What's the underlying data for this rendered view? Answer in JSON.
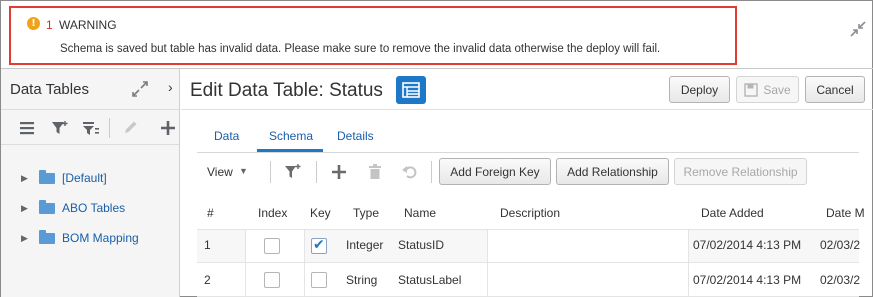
{
  "warning": {
    "icon": "warning-icon",
    "count": "1",
    "title": "WARNING",
    "message": "Schema is saved but table has invalid data. Please make sure to remove the invalid data otherwise the deploy will fail."
  },
  "left_panel": {
    "title": "Data Tables",
    "close_glyph": "›",
    "tree": [
      {
        "label": "[Default]"
      },
      {
        "label": "ABO Tables"
      },
      {
        "label": "BOM Mapping"
      }
    ]
  },
  "main": {
    "title": "Edit Data Table: Status",
    "buttons": {
      "deploy": "Deploy",
      "save": "Save",
      "cancel": "Cancel"
    },
    "tabs": [
      {
        "label": "Data"
      },
      {
        "label": "Schema"
      },
      {
        "label": "Details"
      }
    ],
    "active_tab": "Schema",
    "toolbar": {
      "view_label": "View",
      "add_foreign_key": "Add Foreign Key",
      "add_relationship": "Add Relationship",
      "remove_relationship": "Remove Relationship"
    },
    "table": {
      "headers": {
        "num": "#",
        "index": "Index",
        "key": "Key",
        "type": "Type",
        "name": "Name",
        "description": "Description",
        "date_added": "Date Added",
        "date_modified": "Date M"
      },
      "rows": [
        {
          "num": "1",
          "index": false,
          "key": true,
          "type": "Integer",
          "name": "StatusID",
          "description": "",
          "date_added": "07/02/2014 4:13 PM",
          "date_modified": "02/03/2"
        },
        {
          "num": "2",
          "index": false,
          "key": false,
          "type": "String",
          "name": "StatusLabel",
          "description": "",
          "date_added": "07/02/2014 4:13 PM",
          "date_modified": "02/03/2"
        }
      ]
    }
  },
  "colors": {
    "accent": "#1e78c8",
    "warning_border": "#e03c31",
    "warning_icon": "#f0a31a",
    "link": "#1a5fa8"
  }
}
